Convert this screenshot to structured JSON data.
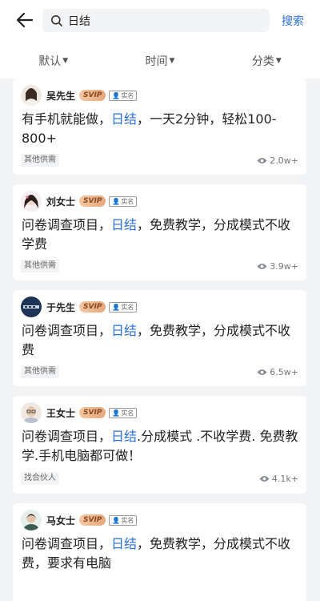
{
  "search": {
    "value": "日结",
    "button_label": "搜索"
  },
  "filters": [
    {
      "label": "默认"
    },
    {
      "label": "时间"
    },
    {
      "label": "分类"
    }
  ],
  "posts": [
    {
      "name": "吴先生",
      "badge": "SVIP",
      "verified": "实名",
      "pre": "有手机就能做，",
      "keyword": "日结",
      "post": "，一天2分钟，轻松100-800+",
      "tag": "其他供需",
      "views": "2.0w+"
    },
    {
      "name": "刘女士",
      "badge": "SVIP",
      "verified": "实名",
      "pre": "问卷调查项目，",
      "keyword": "日结",
      "post": "，免费教学，分成模式不收学费",
      "tag": "其他供需",
      "views": "3.9w+"
    },
    {
      "name": "于先生",
      "badge": "SVIP",
      "verified": "实名",
      "pre": "问卷调查项目，",
      "keyword": "日结",
      "post": "，免费教学，分成模式不收费",
      "tag": "其他供需",
      "views": "6.5w+"
    },
    {
      "name": "王女士",
      "badge": "SVIP",
      "verified": "实名",
      "pre": "问卷调查项目，",
      "keyword": "日结",
      "post": ".分成模式 .不收学费. 免费教学.手机电脑都可做！",
      "tag": "找合伙人",
      "views": "4.1k+"
    },
    {
      "name": "马女士",
      "badge": "SVIP",
      "verified": "实名",
      "pre": "问卷调查项目，",
      "keyword": "日结",
      "post": "，免费教学，分成模式不收费，要求有电脑",
      "tag": "",
      "views": ""
    }
  ]
}
